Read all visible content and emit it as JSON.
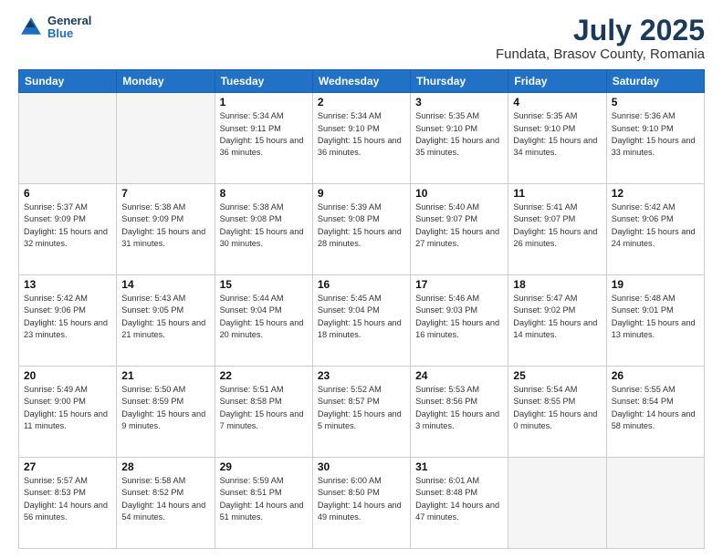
{
  "header": {
    "logo": {
      "general": "General",
      "blue": "Blue"
    },
    "title": "July 2025",
    "subtitle": "Fundata, Brasov County, Romania"
  },
  "calendar": {
    "weekdays": [
      "Sunday",
      "Monday",
      "Tuesday",
      "Wednesday",
      "Thursday",
      "Friday",
      "Saturday"
    ],
    "weeks": [
      [
        {
          "day": "",
          "info": ""
        },
        {
          "day": "",
          "info": ""
        },
        {
          "day": "1",
          "info": "Sunrise: 5:34 AM\nSunset: 9:11 PM\nDaylight: 15 hours\nand 36 minutes."
        },
        {
          "day": "2",
          "info": "Sunrise: 5:34 AM\nSunset: 9:10 PM\nDaylight: 15 hours\nand 36 minutes."
        },
        {
          "day": "3",
          "info": "Sunrise: 5:35 AM\nSunset: 9:10 PM\nDaylight: 15 hours\nand 35 minutes."
        },
        {
          "day": "4",
          "info": "Sunrise: 5:35 AM\nSunset: 9:10 PM\nDaylight: 15 hours\nand 34 minutes."
        },
        {
          "day": "5",
          "info": "Sunrise: 5:36 AM\nSunset: 9:10 PM\nDaylight: 15 hours\nand 33 minutes."
        }
      ],
      [
        {
          "day": "6",
          "info": "Sunrise: 5:37 AM\nSunset: 9:09 PM\nDaylight: 15 hours\nand 32 minutes."
        },
        {
          "day": "7",
          "info": "Sunrise: 5:38 AM\nSunset: 9:09 PM\nDaylight: 15 hours\nand 31 minutes."
        },
        {
          "day": "8",
          "info": "Sunrise: 5:38 AM\nSunset: 9:08 PM\nDaylight: 15 hours\nand 30 minutes."
        },
        {
          "day": "9",
          "info": "Sunrise: 5:39 AM\nSunset: 9:08 PM\nDaylight: 15 hours\nand 28 minutes."
        },
        {
          "day": "10",
          "info": "Sunrise: 5:40 AM\nSunset: 9:07 PM\nDaylight: 15 hours\nand 27 minutes."
        },
        {
          "day": "11",
          "info": "Sunrise: 5:41 AM\nSunset: 9:07 PM\nDaylight: 15 hours\nand 26 minutes."
        },
        {
          "day": "12",
          "info": "Sunrise: 5:42 AM\nSunset: 9:06 PM\nDaylight: 15 hours\nand 24 minutes."
        }
      ],
      [
        {
          "day": "13",
          "info": "Sunrise: 5:42 AM\nSunset: 9:06 PM\nDaylight: 15 hours\nand 23 minutes."
        },
        {
          "day": "14",
          "info": "Sunrise: 5:43 AM\nSunset: 9:05 PM\nDaylight: 15 hours\nand 21 minutes."
        },
        {
          "day": "15",
          "info": "Sunrise: 5:44 AM\nSunset: 9:04 PM\nDaylight: 15 hours\nand 20 minutes."
        },
        {
          "day": "16",
          "info": "Sunrise: 5:45 AM\nSunset: 9:04 PM\nDaylight: 15 hours\nand 18 minutes."
        },
        {
          "day": "17",
          "info": "Sunrise: 5:46 AM\nSunset: 9:03 PM\nDaylight: 15 hours\nand 16 minutes."
        },
        {
          "day": "18",
          "info": "Sunrise: 5:47 AM\nSunset: 9:02 PM\nDaylight: 15 hours\nand 14 minutes."
        },
        {
          "day": "19",
          "info": "Sunrise: 5:48 AM\nSunset: 9:01 PM\nDaylight: 15 hours\nand 13 minutes."
        }
      ],
      [
        {
          "day": "20",
          "info": "Sunrise: 5:49 AM\nSunset: 9:00 PM\nDaylight: 15 hours\nand 11 minutes."
        },
        {
          "day": "21",
          "info": "Sunrise: 5:50 AM\nSunset: 8:59 PM\nDaylight: 15 hours\nand 9 minutes."
        },
        {
          "day": "22",
          "info": "Sunrise: 5:51 AM\nSunset: 8:58 PM\nDaylight: 15 hours\nand 7 minutes."
        },
        {
          "day": "23",
          "info": "Sunrise: 5:52 AM\nSunset: 8:57 PM\nDaylight: 15 hours\nand 5 minutes."
        },
        {
          "day": "24",
          "info": "Sunrise: 5:53 AM\nSunset: 8:56 PM\nDaylight: 15 hours\nand 3 minutes."
        },
        {
          "day": "25",
          "info": "Sunrise: 5:54 AM\nSunset: 8:55 PM\nDaylight: 15 hours\nand 0 minutes."
        },
        {
          "day": "26",
          "info": "Sunrise: 5:55 AM\nSunset: 8:54 PM\nDaylight: 14 hours\nand 58 minutes."
        }
      ],
      [
        {
          "day": "27",
          "info": "Sunrise: 5:57 AM\nSunset: 8:53 PM\nDaylight: 14 hours\nand 56 minutes."
        },
        {
          "day": "28",
          "info": "Sunrise: 5:58 AM\nSunset: 8:52 PM\nDaylight: 14 hours\nand 54 minutes."
        },
        {
          "day": "29",
          "info": "Sunrise: 5:59 AM\nSunset: 8:51 PM\nDaylight: 14 hours\nand 51 minutes."
        },
        {
          "day": "30",
          "info": "Sunrise: 6:00 AM\nSunset: 8:50 PM\nDaylight: 14 hours\nand 49 minutes."
        },
        {
          "day": "31",
          "info": "Sunrise: 6:01 AM\nSunset: 8:48 PM\nDaylight: 14 hours\nand 47 minutes."
        },
        {
          "day": "",
          "info": ""
        },
        {
          "day": "",
          "info": ""
        }
      ]
    ]
  }
}
